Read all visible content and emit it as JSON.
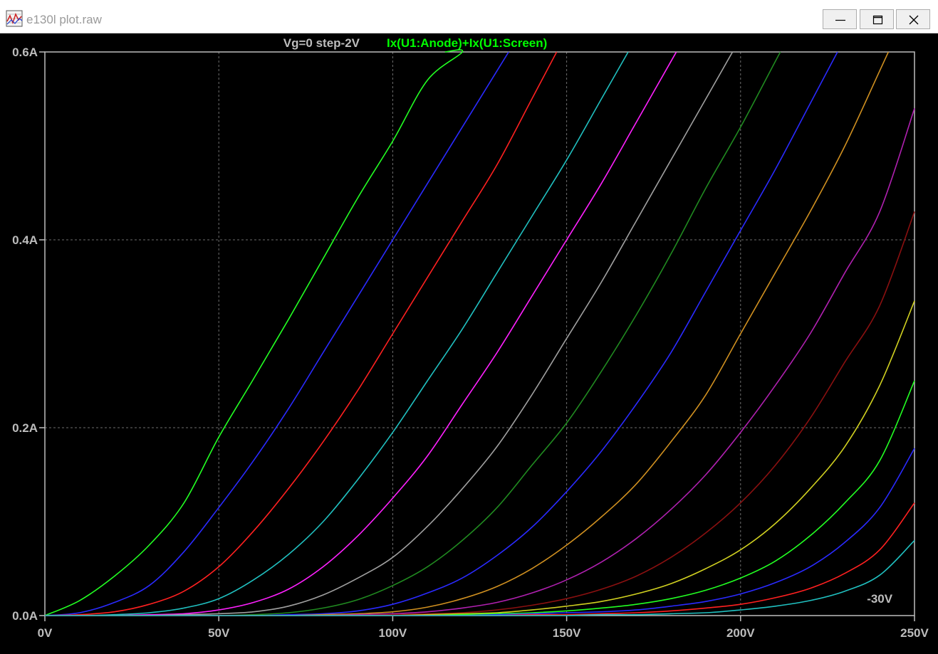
{
  "window": {
    "title": "e130l plot.raw",
    "icon": "plot-waveform-icon",
    "buttons": [
      {
        "icon": "minimize-icon"
      },
      {
        "icon": "maximize-icon"
      },
      {
        "icon": "close-icon"
      }
    ]
  },
  "chart_data": {
    "type": "line",
    "title_left": "Vg=0 step-2V",
    "title_trace": "Ix(U1:Anode)+Ix(U1:Screen)",
    "trace_color": "#00ff00",
    "title_color": "#bdbdbd",
    "background": "#000000",
    "axis_color": "#bdbdbd",
    "grid": true,
    "xlabel": "",
    "ylabel": "",
    "xlim": [
      0,
      250
    ],
    "ylim": [
      0,
      0.6
    ],
    "x_ticks": [
      {
        "value": 0,
        "label": "0V"
      },
      {
        "value": 50,
        "label": "50V"
      },
      {
        "value": 100,
        "label": "100V"
      },
      {
        "value": 150,
        "label": "150V"
      },
      {
        "value": 200,
        "label": "200V"
      },
      {
        "value": 250,
        "label": "250V"
      }
    ],
    "y_ticks": [
      {
        "value": 0,
        "label": "0.0A"
      },
      {
        "value": 0.2,
        "label": "0.2A"
      },
      {
        "value": 0.4,
        "label": "0.4A"
      },
      {
        "value": 0.6,
        "label": "0.6A"
      }
    ],
    "annotations": [
      {
        "text": "-30V",
        "x": 240,
        "y": 0.018
      }
    ],
    "x": [
      0,
      10,
      20,
      30,
      40,
      50,
      60,
      70,
      80,
      90,
      100,
      110,
      120,
      130,
      140,
      150,
      160,
      170,
      180,
      190,
      200,
      210,
      220,
      230,
      240,
      250
    ],
    "series": [
      {
        "color": "#22ff22",
        "values": [
          0,
          0.016,
          0.042,
          0.075,
          0.12,
          0.19,
          0.252,
          0.315,
          0.38,
          0.445,
          0.505,
          0.57,
          0.63,
          null,
          null,
          null,
          null,
          null,
          null,
          null,
          null,
          null,
          null,
          null,
          null,
          null
        ]
      },
      {
        "color": "#2a2aff",
        "values": [
          0,
          0.003,
          0.014,
          0.032,
          0.068,
          0.115,
          0.165,
          0.22,
          0.28,
          0.34,
          0.4,
          0.46,
          0.52,
          0.58,
          null,
          null,
          null,
          null,
          null,
          null,
          null,
          null,
          null,
          null,
          null,
          null
        ]
      },
      {
        "color": "#ff2020",
        "values": [
          0,
          0.001,
          0.004,
          0.012,
          0.026,
          0.052,
          0.09,
          0.135,
          0.185,
          0.24,
          0.3,
          0.36,
          0.42,
          0.48,
          0.55,
          null,
          null,
          null,
          null,
          null,
          null,
          null,
          null,
          null,
          null,
          null
        ]
      },
      {
        "color": "#20c0c0",
        "values": [
          0,
          0,
          0.001,
          0.003,
          0.008,
          0.018,
          0.038,
          0.065,
          0.1,
          0.145,
          0.195,
          0.25,
          0.305,
          0.365,
          0.425,
          0.485,
          0.55,
          null,
          null,
          null,
          null,
          null,
          null,
          null,
          null,
          null
        ]
      },
      {
        "color": "#ff20ff",
        "values": [
          0,
          0,
          0,
          0.001,
          0.002,
          0.006,
          0.014,
          0.028,
          0.052,
          0.085,
          0.125,
          0.17,
          0.225,
          0.28,
          0.34,
          0.4,
          0.46,
          0.525,
          0.59,
          null,
          null,
          null,
          null,
          null,
          null,
          null
        ]
      },
      {
        "color": "#a0a0a0",
        "values": [
          0,
          0,
          0,
          0,
          0.001,
          0.002,
          0.004,
          0.01,
          0.022,
          0.04,
          0.062,
          0.095,
          0.135,
          0.18,
          0.235,
          0.295,
          0.355,
          0.42,
          0.485,
          0.55,
          null,
          null,
          null,
          null,
          null,
          null
        ]
      },
      {
        "color": "#208a20",
        "values": [
          0,
          0,
          0,
          0,
          0,
          0,
          0.001,
          0.003,
          0.008,
          0.017,
          0.032,
          0.052,
          0.08,
          0.115,
          0.16,
          0.205,
          0.26,
          0.32,
          0.385,
          0.455,
          0.52,
          0.59,
          null,
          null,
          null,
          null
        ]
      },
      {
        "color": "#2a2aff",
        "values": [
          0,
          0,
          0,
          0,
          0,
          0,
          0,
          0.001,
          0.002,
          0.005,
          0.012,
          0.024,
          0.04,
          0.064,
          0.094,
          0.132,
          0.175,
          0.225,
          0.28,
          0.345,
          0.41,
          0.475,
          0.545,
          null,
          null,
          null
        ]
      },
      {
        "color": "#d09020",
        "values": [
          0,
          0,
          0,
          0,
          0,
          0,
          0,
          0,
          0.001,
          0.002,
          0.004,
          0.009,
          0.018,
          0.031,
          0.05,
          0.075,
          0.105,
          0.14,
          0.185,
          0.235,
          0.3,
          0.365,
          0.43,
          0.5,
          0.58,
          null
        ]
      },
      {
        "color": "#b020b0",
        "values": [
          0,
          0,
          0,
          0,
          0,
          0,
          0,
          0,
          0,
          0.001,
          0.002,
          0.004,
          0.008,
          0.014,
          0.024,
          0.038,
          0.057,
          0.082,
          0.113,
          0.15,
          0.195,
          0.245,
          0.3,
          0.365,
          0.43,
          0.54
        ]
      },
      {
        "color": "#8a1010",
        "values": [
          0,
          0,
          0,
          0,
          0,
          0,
          0,
          0,
          0,
          0,
          0.001,
          0.002,
          0.003,
          0.006,
          0.011,
          0.018,
          0.028,
          0.042,
          0.062,
          0.088,
          0.12,
          0.16,
          0.21,
          0.27,
          0.33,
          0.43
        ]
      },
      {
        "color": "#d0d020",
        "values": [
          0,
          0,
          0,
          0,
          0,
          0,
          0,
          0,
          0,
          0,
          0,
          0.001,
          0.002,
          0.003,
          0.006,
          0.01,
          0.015,
          0.023,
          0.034,
          0.05,
          0.07,
          0.098,
          0.135,
          0.18,
          0.245,
          0.335
        ]
      },
      {
        "color": "#22ff22",
        "values": [
          0,
          0,
          0,
          0,
          0,
          0,
          0,
          0,
          0,
          0,
          0,
          0,
          0.001,
          0.002,
          0.003,
          0.005,
          0.008,
          0.012,
          0.018,
          0.027,
          0.04,
          0.058,
          0.085,
          0.12,
          0.165,
          0.25
        ]
      },
      {
        "color": "#2a2aff",
        "values": [
          0,
          0,
          0,
          0,
          0,
          0,
          0,
          0,
          0,
          0,
          0,
          0,
          0,
          0.001,
          0.002,
          0.003,
          0.004,
          0.006,
          0.01,
          0.015,
          0.023,
          0.035,
          0.052,
          0.078,
          0.115,
          0.178
        ]
      },
      {
        "color": "#ff2020",
        "values": [
          0,
          0,
          0,
          0,
          0,
          0,
          0,
          0,
          0,
          0,
          0,
          0,
          0,
          0,
          0.001,
          0.001,
          0.002,
          0.003,
          0.005,
          0.008,
          0.012,
          0.019,
          0.029,
          0.045,
          0.07,
          0.12
        ]
      },
      {
        "color": "#20c0c0",
        "values": [
          0,
          0,
          0,
          0,
          0,
          0,
          0,
          0,
          0,
          0,
          0,
          0,
          0,
          0,
          0,
          0,
          0.001,
          0.001,
          0.002,
          0.003,
          0.006,
          0.01,
          0.016,
          0.026,
          0.043,
          0.08
        ]
      }
    ]
  }
}
